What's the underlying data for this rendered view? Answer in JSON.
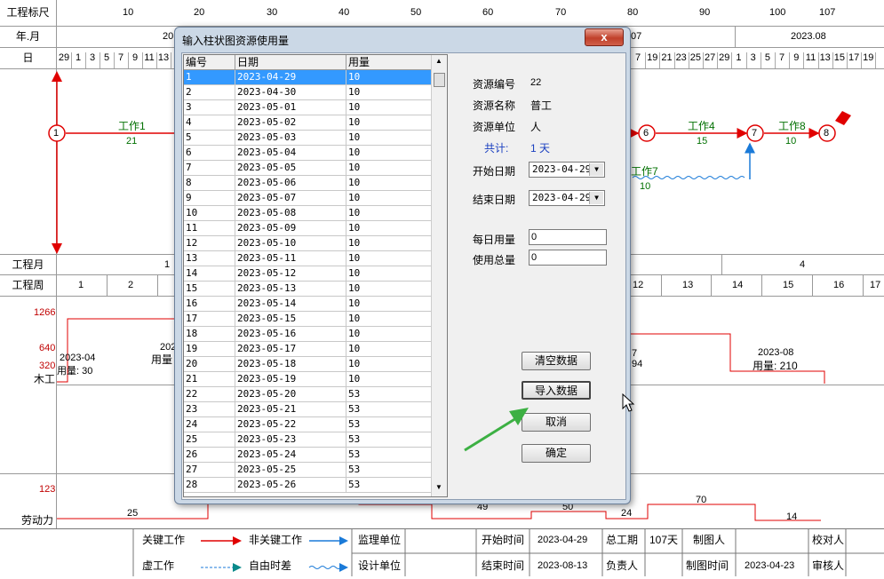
{
  "header": {
    "row1_label": "工程标尺",
    "row1_ticks": [
      "10",
      "20",
      "30",
      "40",
      "50",
      "60",
      "70",
      "80",
      "90",
      "100",
      "107"
    ],
    "row2_label": "年.月",
    "row2_items": [
      "20",
      "07",
      "2023.08"
    ],
    "row3_label": "日",
    "row3_days_left": [
      "29",
      "1",
      "3",
      "5",
      "7",
      "9",
      "11",
      "13"
    ],
    "row3_days_right": [
      "7",
      "19",
      "21",
      "23",
      "25",
      "27",
      "29",
      "1",
      "3",
      "5",
      "7",
      "9",
      "11",
      "13",
      "15",
      "17",
      "19"
    ]
  },
  "network": {
    "nodes": [
      "1",
      "6",
      "7",
      "8"
    ],
    "work1_name": "工作1",
    "work1_dur": "21",
    "work4_name": "工作4",
    "work4_dur": "15",
    "work8_name": "工作8",
    "work8_dur": "10",
    "work7_name": "工作7",
    "work7_dur": "10"
  },
  "timeline": {
    "month_label": "工程月",
    "month_left": "1",
    "month_right": "4",
    "week_label": "工程周",
    "weeks_left": [
      "1",
      "2"
    ],
    "weeks_right": [
      "12",
      "13",
      "14",
      "15",
      "16",
      "17"
    ]
  },
  "histogram": {
    "y_1266": "1266",
    "y_640": "640",
    "y_320": "320",
    "row1_label": "木工",
    "l1_month": "2023-04",
    "l1_use": "用量: 30",
    "l2_month": "202",
    "l2_use": "用量",
    "r1_month": "7",
    "r1_use": "94",
    "r2_month": "2023-08",
    "r2_use": "用量: 210",
    "y_123": "123",
    "row2_label": "劳动力",
    "v25": "25",
    "v49": "49",
    "v50": "50",
    "v24": "24",
    "v70": "70",
    "v14": "14"
  },
  "legend": {
    "critical": "关键工作",
    "noncritical": "非关键工作",
    "virtual": "虚工作",
    "free_float": "自由时差",
    "supervision": "监理单位",
    "design": "设计单位",
    "start_label": "开始时间",
    "start_value": "2023-04-29",
    "end_label": "结束时间",
    "end_value": "2023-08-13",
    "total_label": "总工期",
    "total_value": "107天",
    "responsible": "负责人",
    "drawer": "制图人",
    "draw_time_label": "制图时间",
    "draw_time_value": "2023-04-23",
    "checker": "校对人",
    "reviewer": "审核人"
  },
  "dialog": {
    "title": "输入柱状图资源使用量",
    "close": "x",
    "columns": [
      "编号",
      "日期",
      "用量"
    ],
    "rows": [
      [
        "1",
        "2023-04-29",
        "10"
      ],
      [
        "2",
        "2023-04-30",
        "10"
      ],
      [
        "3",
        "2023-05-01",
        "10"
      ],
      [
        "4",
        "2023-05-02",
        "10"
      ],
      [
        "5",
        "2023-05-03",
        "10"
      ],
      [
        "6",
        "2023-05-04",
        "10"
      ],
      [
        "7",
        "2023-05-05",
        "10"
      ],
      [
        "8",
        "2023-05-06",
        "10"
      ],
      [
        "9",
        "2023-05-07",
        "10"
      ],
      [
        "10",
        "2023-05-08",
        "10"
      ],
      [
        "11",
        "2023-05-09",
        "10"
      ],
      [
        "12",
        "2023-05-10",
        "10"
      ],
      [
        "13",
        "2023-05-11",
        "10"
      ],
      [
        "14",
        "2023-05-12",
        "10"
      ],
      [
        "15",
        "2023-05-13",
        "10"
      ],
      [
        "16",
        "2023-05-14",
        "10"
      ],
      [
        "17",
        "2023-05-15",
        "10"
      ],
      [
        "18",
        "2023-05-16",
        "10"
      ],
      [
        "19",
        "2023-05-17",
        "10"
      ],
      [
        "20",
        "2023-05-18",
        "10"
      ],
      [
        "21",
        "2023-05-19",
        "10"
      ],
      [
        "22",
        "2023-05-20",
        "53"
      ],
      [
        "23",
        "2023-05-21",
        "53"
      ],
      [
        "24",
        "2023-05-22",
        "53"
      ],
      [
        "25",
        "2023-05-23",
        "53"
      ],
      [
        "26",
        "2023-05-24",
        "53"
      ],
      [
        "27",
        "2023-05-25",
        "53"
      ],
      [
        "28",
        "2023-05-26",
        "53"
      ]
    ],
    "resource_id_label": "资源编号",
    "resource_id": "22",
    "resource_name_label": "资源名称",
    "resource_name": "普工",
    "resource_unit_label": "资源单位",
    "resource_unit": "人",
    "total_label": "共计:",
    "total_value": "1 天",
    "start_label": "开始日期",
    "start_value": "2023-04-29",
    "end_label": "结束日期",
    "end_value": "2023-04-29",
    "daily_label": "每日用量",
    "daily_value": "0",
    "sum_label": "使用总量",
    "sum_value": "0",
    "btn_clear": "清空数据",
    "btn_import": "导入数据",
    "btn_cancel": "取消",
    "btn_ok": "确定"
  },
  "colors": {
    "critical": "#e00000",
    "noncritical": "#1a7ad8",
    "text_green": "#007000",
    "accent_arrow": "#3cb043"
  }
}
